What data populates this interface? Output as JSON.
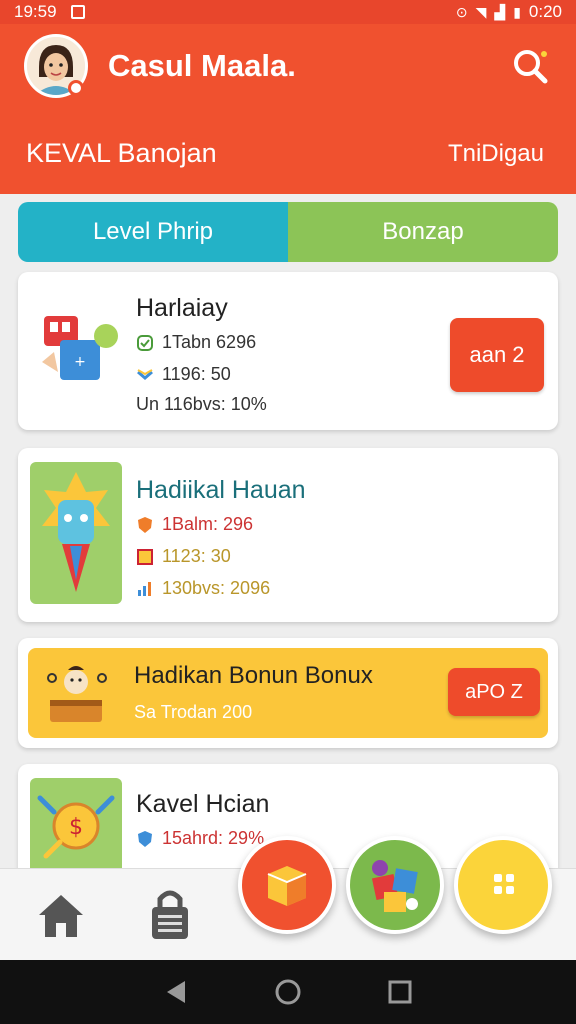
{
  "status_bar": {
    "time_left": "19:59",
    "time_right": "0:20"
  },
  "header": {
    "title": "Casul Maala.",
    "left_label": "KEVAL Banojan",
    "right_label": "TniDigau",
    "accent": "#f0512f"
  },
  "tabs": [
    {
      "label": "Level Phrip",
      "color": "#23b2c7"
    },
    {
      "label": "Bonzap",
      "color": "#8cc457"
    }
  ],
  "cards": [
    {
      "title": "Harlaiay",
      "stats": [
        "1Tabn 6296",
        "1196: 50",
        "Un 116bvs: 10%"
      ],
      "button": "aan 2"
    },
    {
      "title": "Hadiikal Hauan",
      "stats": [
        "1Balm: 296",
        "1123: 30",
        "130bvs: 2096"
      ]
    },
    {
      "title": "Hadikan Bonun Bonux",
      "subtitle": "Sa Trodan 200",
      "button": "aPO Z"
    },
    {
      "title": "Kavel Hcian",
      "stats": [
        "15ahrd: 29%"
      ]
    }
  ],
  "icons": {
    "search": "search-icon",
    "home": "home-icon",
    "lock": "lock-icon"
  }
}
